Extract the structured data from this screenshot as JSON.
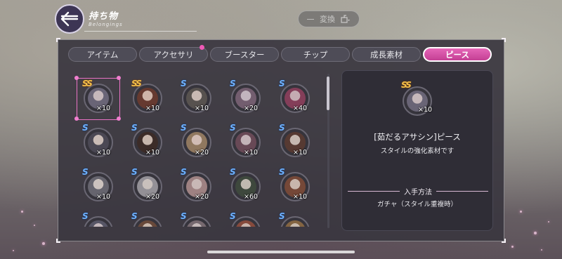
{
  "header": {
    "title": "持ち物",
    "subtitle": "Belongings",
    "convert_label": "変換"
  },
  "tabs": [
    {
      "label": "アイテム",
      "active": false,
      "badge": false
    },
    {
      "label": "アクセサリ",
      "active": false,
      "badge": true
    },
    {
      "label": "ブースター",
      "active": false,
      "badge": false
    },
    {
      "label": "チップ",
      "active": false,
      "badge": false
    },
    {
      "label": "成長素材",
      "active": false,
      "badge": false
    },
    {
      "label": "ピース",
      "active": true,
      "badge": false
    }
  ],
  "pieces": [
    {
      "rank": "SS",
      "qty": "×10",
      "selected": true
    },
    {
      "rank": "SS",
      "qty": "×10"
    },
    {
      "rank": "S",
      "qty": "×10"
    },
    {
      "rank": "S",
      "qty": "×20"
    },
    {
      "rank": "S",
      "qty": "×40"
    },
    {
      "rank": "S",
      "qty": "×10"
    },
    {
      "rank": "S",
      "qty": "×10"
    },
    {
      "rank": "S",
      "qty": "×20"
    },
    {
      "rank": "S",
      "qty": "×10"
    },
    {
      "rank": "S",
      "qty": "×10"
    },
    {
      "rank": "S",
      "qty": "×10"
    },
    {
      "rank": "S",
      "qty": "×20"
    },
    {
      "rank": "S",
      "qty": "×20"
    },
    {
      "rank": "S",
      "qty": "×60"
    },
    {
      "rank": "S",
      "qty": "×10"
    },
    {
      "rank": "S",
      "qty": ""
    },
    {
      "rank": "S",
      "qty": ""
    },
    {
      "rank": "S",
      "qty": ""
    },
    {
      "rank": "S",
      "qty": ""
    },
    {
      "rank": "S",
      "qty": ""
    }
  ],
  "detail": {
    "rank": "SS",
    "qty": "×10",
    "name": "[茹だるアサシン]ピース",
    "description": "スタイルの強化素材です",
    "how_to_obtain_label": "入手方法",
    "how_to_obtain_value": "ガチャ（スタイル重複時）"
  },
  "colors": {
    "accent_pink": "#d94ca6",
    "rank_ss": "#f5c04a",
    "rank_s": "#6fb2ff"
  }
}
